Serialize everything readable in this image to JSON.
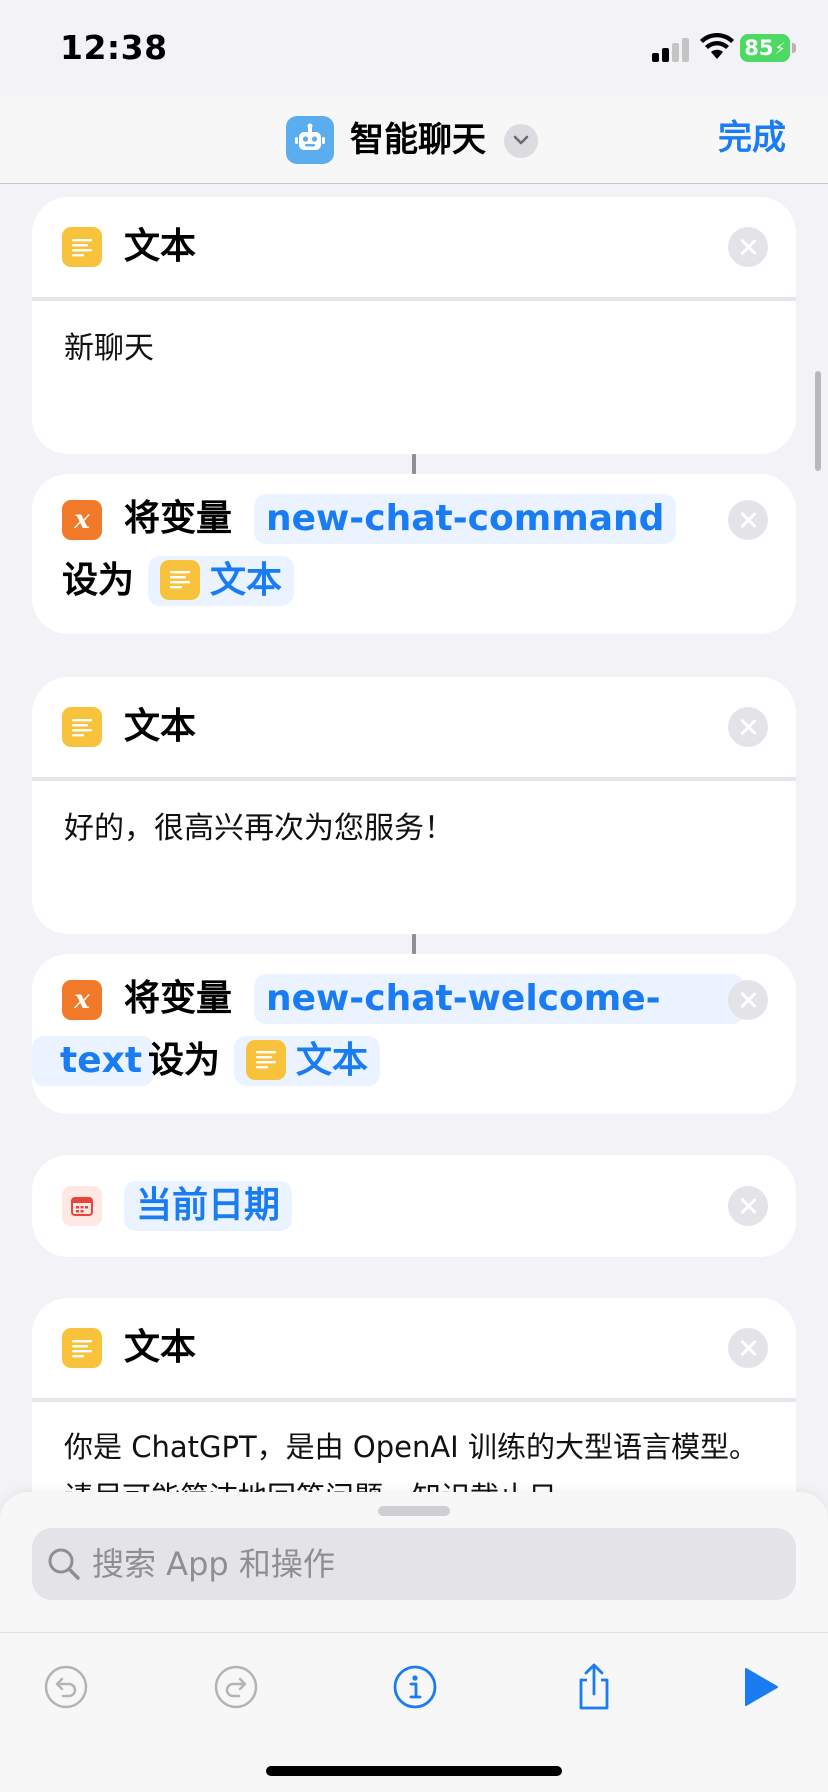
{
  "status_bar": {
    "time": "12:38",
    "battery_level": "85"
  },
  "nav": {
    "title": "智能聊天",
    "done_label": "完成",
    "app_icon": "robot-icon"
  },
  "actions": [
    {
      "type": "text",
      "title": "文本",
      "content": "新聊天"
    },
    {
      "type": "set_variable",
      "verb": "将变量",
      "variable": "new-chat-command",
      "connector": "设为",
      "value": "文本"
    },
    {
      "type": "text",
      "title": "文本",
      "content": "好的，很高兴再次为您服务！"
    },
    {
      "type": "set_variable",
      "verb": "将变量",
      "variable_line1": "new-chat-welcome-",
      "variable_line2": "text",
      "connector": "设为",
      "value": "文本"
    },
    {
      "type": "current_date",
      "title": "当前日期"
    },
    {
      "type": "text",
      "title": "文本",
      "content": "你是 ChatGPT，是由 OpenAI 训练的大型语言模型。请尽可能简洁地回答问题。知识截止日"
    }
  ],
  "search": {
    "placeholder": "搜索 App 和操作",
    "value": ""
  },
  "toolbar": {
    "undo": "undo-icon",
    "redo": "redo-icon",
    "info": "info-icon",
    "share": "share-icon",
    "run": "play-icon"
  },
  "colors": {
    "accent": "#1a7cf2",
    "text_action": "#f9c23c",
    "variable_action": "#f07a2a",
    "background": "#f2f2f7"
  }
}
